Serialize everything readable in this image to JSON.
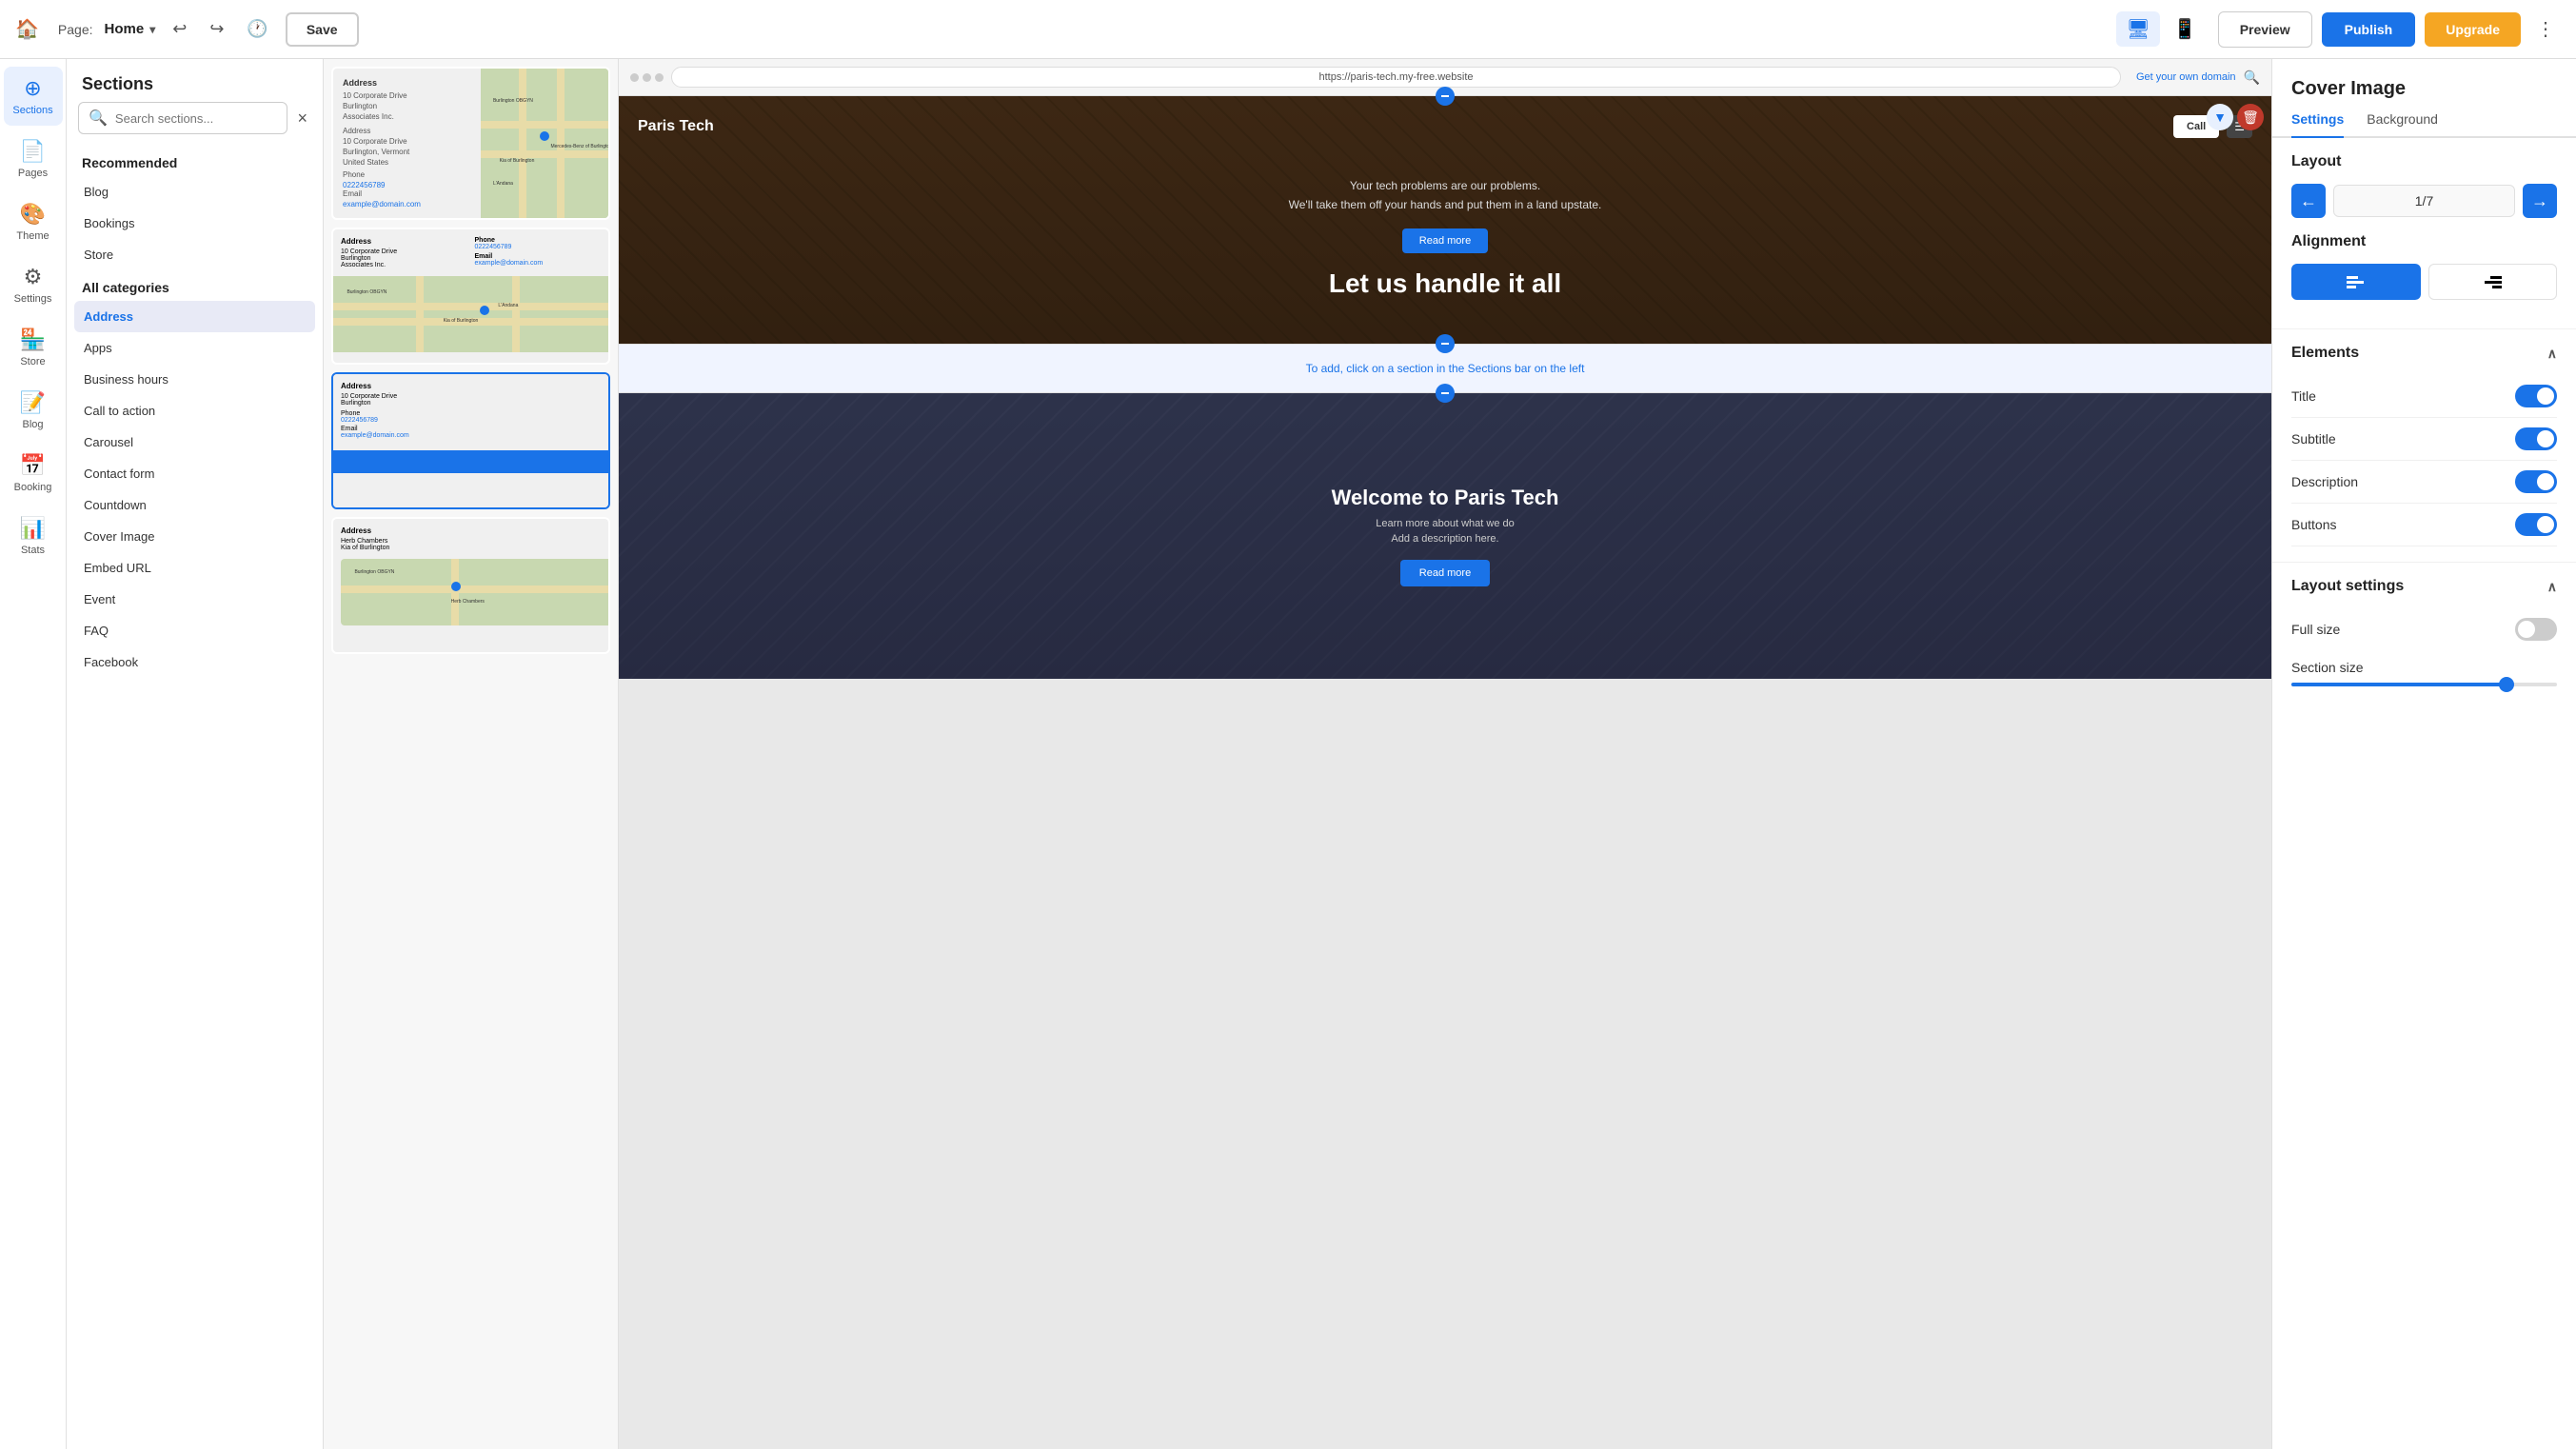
{
  "topbar": {
    "page_label": "Page:",
    "page_name": "Home",
    "save_label": "Save",
    "preview_label": "Preview",
    "publish_label": "Publish",
    "upgrade_label": "Upgrade"
  },
  "sidebar_nav": {
    "items": [
      {
        "id": "sections",
        "label": "Sections",
        "icon": "⊕",
        "active": true
      },
      {
        "id": "pages",
        "label": "Pages",
        "icon": "📄"
      },
      {
        "id": "theme",
        "label": "Theme",
        "icon": "🎨"
      },
      {
        "id": "settings",
        "label": "Settings",
        "icon": "⚙"
      },
      {
        "id": "store",
        "label": "Store",
        "icon": "🏪"
      },
      {
        "id": "blog",
        "label": "Blog",
        "icon": "📝"
      },
      {
        "id": "booking",
        "label": "Booking",
        "icon": "📅"
      },
      {
        "id": "stats",
        "label": "Stats",
        "icon": "📊"
      }
    ]
  },
  "sections_panel": {
    "title": "Sections",
    "search_placeholder": "Search sections...",
    "close_icon": "×",
    "recommended_label": "Recommended",
    "recommended_items": [
      "Blog",
      "Bookings",
      "Store"
    ],
    "all_categories_label": "All categories",
    "category_items": [
      {
        "id": "address",
        "label": "Address",
        "active": true
      },
      {
        "id": "apps",
        "label": "Apps"
      },
      {
        "id": "business_hours",
        "label": "Business hours"
      },
      {
        "id": "call_to_action",
        "label": "Call to action"
      },
      {
        "id": "carousel",
        "label": "Carousel"
      },
      {
        "id": "contact_form",
        "label": "Contact form"
      },
      {
        "id": "countdown",
        "label": "Countdown"
      },
      {
        "id": "cover_image",
        "label": "Cover Image"
      },
      {
        "id": "embed_url",
        "label": "Embed URL"
      },
      {
        "id": "event",
        "label": "Event"
      },
      {
        "id": "faq",
        "label": "FAQ"
      },
      {
        "id": "facebook",
        "label": "Facebook"
      }
    ]
  },
  "thumbnails": [
    {
      "id": 1,
      "type": "address_map"
    },
    {
      "id": 2,
      "type": "address_map_large"
    },
    {
      "id": 3,
      "type": "address_blue",
      "selected": true
    },
    {
      "id": 4,
      "type": "address_simple"
    }
  ],
  "browser": {
    "url": "https://paris-tech.my-free.website",
    "get_domain": "Get your own domain"
  },
  "preview": {
    "hero": {
      "brand": "Paris Tech",
      "call_button": "Call",
      "subtitle": "Your tech problems are our problems.",
      "subtitle2": "We'll take them off your hands and put them in a land upstate.",
      "read_more": "Read more",
      "title": "Let us handle it all"
    },
    "add_section_text": "To add, click on a section in the Sections bar on the left",
    "welcome": {
      "title": "Welcome to Paris Tech",
      "subtitle": "Learn more about what we do",
      "desc": "Add a description here.",
      "button": "Read more"
    }
  },
  "right_panel": {
    "title": "Cover Image",
    "tab_settings": "Settings",
    "tab_background": "Background",
    "layout_label": "Layout",
    "layout_value": "1/7",
    "alignment_label": "Alignment",
    "elements_label": "Elements",
    "elements": [
      {
        "label": "Title",
        "on": true
      },
      {
        "label": "Subtitle",
        "on": true
      },
      {
        "label": "Description",
        "on": true
      },
      {
        "label": "Buttons",
        "on": true
      }
    ],
    "layout_settings_label": "Layout settings",
    "full_size_label": "Full size",
    "full_size_on": false,
    "section_size_label": "Section size"
  }
}
